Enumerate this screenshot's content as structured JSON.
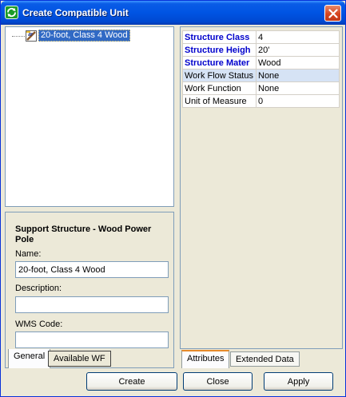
{
  "window": {
    "title": "Create Compatible Unit",
    "accent_color": "#0054e3",
    "close_color": "#d6451f"
  },
  "tree": {
    "items": [
      {
        "label": "20-foot, Class 4 Wood",
        "icon": "pole-icon",
        "selected": true
      }
    ]
  },
  "properties": {
    "heading": "Support Structure - Wood Power Pole",
    "name_label": "Name:",
    "name_value": "20-foot, Class 4 Wood",
    "description_label": "Description:",
    "description_value": "",
    "wms_code_label": "WMS Code:",
    "wms_code_value": ""
  },
  "left_tabs": [
    {
      "label": "General",
      "active": true
    },
    {
      "label": "Available WF",
      "active": false
    }
  ],
  "attributes": {
    "rows": [
      {
        "key": "Structure Class",
        "value": "4",
        "required": true
      },
      {
        "key": "Structure Heigh",
        "value": "20'",
        "required": true
      },
      {
        "key": "Structure Mater",
        "value": "Wood",
        "required": true
      },
      {
        "key": "Work Flow Status",
        "value": "None",
        "required": false
      },
      {
        "key": "Work Function",
        "value": "None",
        "required": false
      },
      {
        "key": "Unit of Measure",
        "value": "0",
        "required": false
      }
    ],
    "required_color": "#0000cc"
  },
  "right_tabs": [
    {
      "label": "Attributes",
      "active": true
    },
    {
      "label": "Extended Data",
      "active": false
    }
  ],
  "buttons": {
    "create": "Create",
    "close": "Close",
    "apply": "Apply"
  }
}
